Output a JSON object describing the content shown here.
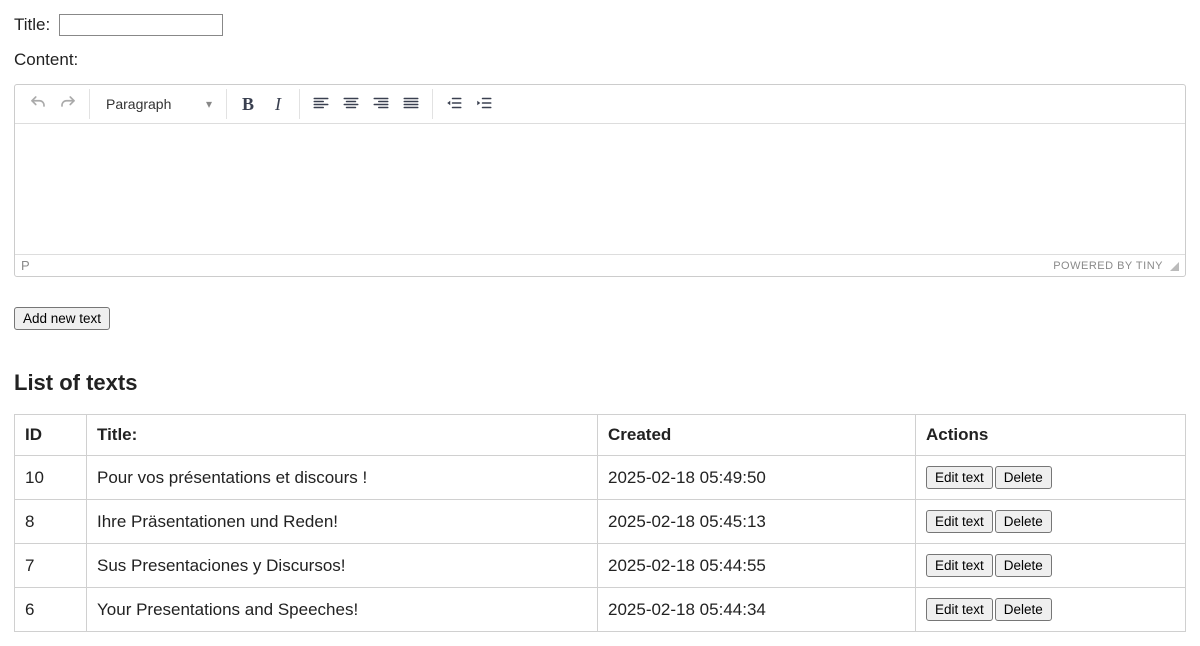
{
  "form": {
    "title_label": "Title:",
    "title_value": "",
    "content_label": "Content:"
  },
  "editor": {
    "format_label": "Paragraph",
    "path": "P",
    "powered": "POWERED BY TINY"
  },
  "buttons": {
    "add_text": "Add new text",
    "edit": "Edit text",
    "delete": "Delete"
  },
  "list_heading": "List of texts",
  "table": {
    "headers": {
      "id": "ID",
      "title": "Title:",
      "created": "Created",
      "actions": "Actions"
    },
    "rows": [
      {
        "id": "10",
        "title": "Pour vos présentations et discours !",
        "created": "2025-02-18 05:49:50"
      },
      {
        "id": "8",
        "title": "Ihre Präsentationen und Reden!",
        "created": "2025-02-18 05:45:13"
      },
      {
        "id": "7",
        "title": "Sus Presentaciones y Discursos!",
        "created": "2025-02-18 05:44:55"
      },
      {
        "id": "6",
        "title": "Your Presentations and Speeches!",
        "created": "2025-02-18 05:44:34"
      }
    ]
  }
}
